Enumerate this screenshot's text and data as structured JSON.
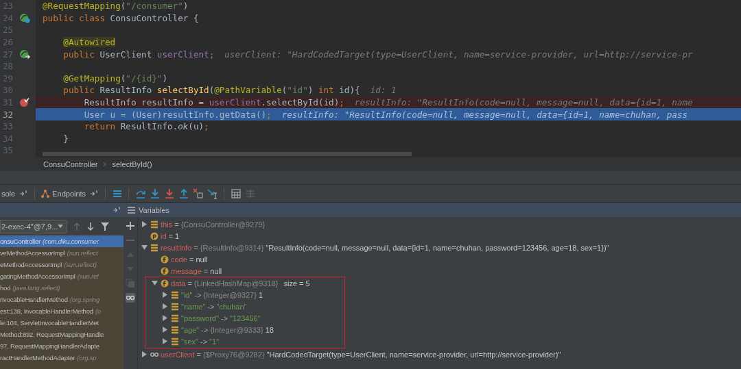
{
  "editor": {
    "lines": [
      {
        "number": "23",
        "kind": "code",
        "breakpoint": false,
        "current": false,
        "tokens": [
          {
            "text": "@RequestMapping",
            "kind": "ann"
          },
          {
            "text": "(",
            "kind": "plain"
          },
          {
            "text": "\"/consumer\"",
            "kind": "str"
          },
          {
            "text": ")",
            "kind": "plain"
          }
        ]
      },
      {
        "number": "24",
        "kind": "bean",
        "breakpoint": false,
        "current": false,
        "tokens": [
          {
            "text": "public class ",
            "kind": "kw"
          },
          {
            "text": "ConsuController {",
            "kind": "plain"
          }
        ]
      },
      {
        "number": "25",
        "kind": "code",
        "breakpoint": false,
        "current": false
      },
      {
        "number": "26",
        "kind": "code",
        "breakpoint": false,
        "current": false,
        "tokens": [
          {
            "text": "    @Autowired",
            "kind": "ann-hl"
          }
        ]
      },
      {
        "number": "27",
        "kind": "bean-link",
        "breakpoint": false,
        "current": false,
        "tokens": [
          {
            "text": "    public ",
            "kind": "kw"
          },
          {
            "text": "UserClient ",
            "kind": "plain"
          },
          {
            "text": "userClient",
            "kind": "field"
          },
          {
            "text": ";",
            "kind": "kw"
          }
        ],
        "hint": "userClient: \"HardCodedTarget(type=UserClient, name=service-provider, url=http://service-pr"
      },
      {
        "number": "28",
        "kind": "code",
        "breakpoint": false,
        "current": false
      },
      {
        "number": "29",
        "kind": "code",
        "breakpoint": false,
        "current": false,
        "tokens": [
          {
            "text": "    @GetMapping",
            "kind": "ann"
          },
          {
            "text": "(",
            "kind": "plain"
          },
          {
            "text": "\"/{id}\"",
            "kind": "str"
          },
          {
            "text": ")",
            "kind": "plain"
          }
        ]
      },
      {
        "number": "30",
        "kind": "code",
        "breakpoint": false,
        "current": false,
        "tokens": [
          {
            "text": "    public ",
            "kind": "kw"
          },
          {
            "text": "ResultInfo ",
            "kind": "plain"
          },
          {
            "text": "selectById",
            "kind": "method"
          },
          {
            "text": "(",
            "kind": "plain"
          },
          {
            "text": "@PathVariable",
            "kind": "ann"
          },
          {
            "text": "(",
            "kind": "plain"
          },
          {
            "text": "\"id\"",
            "kind": "str"
          },
          {
            "text": ") ",
            "kind": "plain"
          },
          {
            "text": "int ",
            "kind": "kw"
          },
          {
            "text": "id){",
            "kind": "plain"
          }
        ],
        "hint": "id: 1"
      },
      {
        "number": "31",
        "kind": "code",
        "breakpoint": true,
        "current": false,
        "tokens": [
          {
            "text": "        ResultInfo resultInfo = ",
            "kind": "plain"
          },
          {
            "text": "userClient",
            "kind": "field"
          },
          {
            "text": ".selectById(id)",
            "kind": "plain"
          },
          {
            "text": ";",
            "kind": "kw"
          }
        ],
        "hint": "resultInfo: \"ResultInfo(code=null, message=null, data={id=1, name"
      },
      {
        "number": "32",
        "kind": "code",
        "breakpoint": false,
        "current": true,
        "tokens": [
          {
            "text": "        User u = (User)resultInfo.getData()",
            "kind": "plain"
          },
          {
            "text": ";",
            "kind": "kw"
          }
        ],
        "hint": "resultInfo: \"ResultInfo(code=null, message=null, data={id=1, name=chuhan, pass"
      },
      {
        "number": "33",
        "kind": "code",
        "breakpoint": false,
        "current": false,
        "tokens": [
          {
            "text": "        return ",
            "kind": "kw"
          },
          {
            "text": "ResultInfo.",
            "kind": "plain"
          },
          {
            "text": "ok",
            "kind": "static"
          },
          {
            "text": "(u)",
            "kind": "plain"
          },
          {
            "text": ";",
            "kind": "kw"
          }
        ]
      },
      {
        "number": "34",
        "kind": "code",
        "breakpoint": false,
        "current": false,
        "tokens": [
          {
            "text": "    }",
            "kind": "plain"
          }
        ]
      },
      {
        "number": "35",
        "kind": "code",
        "breakpoint": false,
        "current": false
      }
    ]
  },
  "breadcrumb": [
    "ConsuController",
    "selectById()"
  ],
  "tool_tabs": [
    {
      "label": "sole",
      "kind": "plain"
    },
    {
      "label": "Endpoints",
      "kind": "endpoints"
    }
  ],
  "frames": {
    "thread": "2-exec-4\"@7,9...",
    "items": [
      {
        "method": "onsuController",
        "location": "(com.diku.consumer",
        "selected": true
      },
      {
        "method": "veMethodAccessorImpl",
        "location": "(sun.reflect",
        "selected": false
      },
      {
        "method": "eMethodAccessorImpl",
        "location": "(sun.reflect)",
        "selected": false
      },
      {
        "method": "gatingMethodAccessorImpl",
        "location": "(sun.ref",
        "selected": false
      },
      {
        "method": "hod",
        "location": "(java.lang.reflect)",
        "selected": false
      },
      {
        "method": "nvocableHandlerMethod",
        "location": "(org.spring",
        "selected": false
      },
      {
        "method": "est:138, InvocableHandlerMethod",
        "location": "(o",
        "selected": false
      },
      {
        "method": "le:104, ServletInvocableHandlerMet",
        "selected": false
      },
      {
        "method": "Method:892, RequestMappingHandle",
        "selected": false
      },
      {
        "method": "97, RequestMappingHandlerAdapte",
        "selected": false
      },
      {
        "method": "ractHandlerMethodAdapter",
        "location": "(org.sp",
        "selected": false
      }
    ]
  },
  "variables": {
    "title": "Variables",
    "nodes": [
      {
        "kind": "object",
        "name": "this",
        "sep": "=",
        "ref": "{ConsuController@9279}",
        "expanded": false,
        "highlighted": false
      },
      {
        "kind": "param",
        "name": "id",
        "sep": "=",
        "value": "1",
        "highlighted": false
      },
      {
        "kind": "object",
        "name": "resultInfo",
        "sep": "=",
        "ref": "{ResultInfo@9314}",
        "value": "\"ResultInfo(code=null, message=null, data={id=1, name=chuhan, password=123456, age=18, sex=1})\"",
        "expanded": true,
        "highlighted": false,
        "children": [
          {
            "kind": "field",
            "name": "code",
            "sep": "=",
            "value": "null",
            "highlighted": false
          },
          {
            "kind": "field",
            "name": "message",
            "sep": "=",
            "value": "null",
            "highlighted": false
          },
          {
            "kind": "field",
            "name": "data",
            "sep": "=",
            "ref": "{LinkedHashMap@9318}",
            "extra": "size = 5",
            "expanded": true,
            "highlighted": true,
            "children": [
              {
                "kind": "entry",
                "name": "\"id\"",
                "sep": "->",
                "ref": "{Integer@9327}",
                "value": "1",
                "expanded": false,
                "highlighted": false
              },
              {
                "kind": "string-entry",
                "name": "\"name\"",
                "sep": "->",
                "value": "\"chuhan\"",
                "expanded": false,
                "highlighted": false
              },
              {
                "kind": "string-entry",
                "name": "\"password\"",
                "sep": "->",
                "value": "\"123456\"",
                "expanded": false,
                "highlighted": false
              },
              {
                "kind": "entry",
                "name": "\"age\"",
                "sep": "->",
                "ref": "{Integer@9333}",
                "value": "18",
                "expanded": false,
                "highlighted": false
              },
              {
                "kind": "string-entry",
                "name": "\"sex\"",
                "sep": "->",
                "value": "\"1\"",
                "expanded": false,
                "highlighted": false
              }
            ]
          }
        ]
      },
      {
        "kind": "watch",
        "name": "userClient",
        "sep": "=",
        "ref": "{$Proxy76@9282}",
        "value": "\"HardCodedTarget(type=UserClient, name=service-provider, url=http://service-provider)\"",
        "expanded": false,
        "highlighted": false
      }
    ]
  }
}
